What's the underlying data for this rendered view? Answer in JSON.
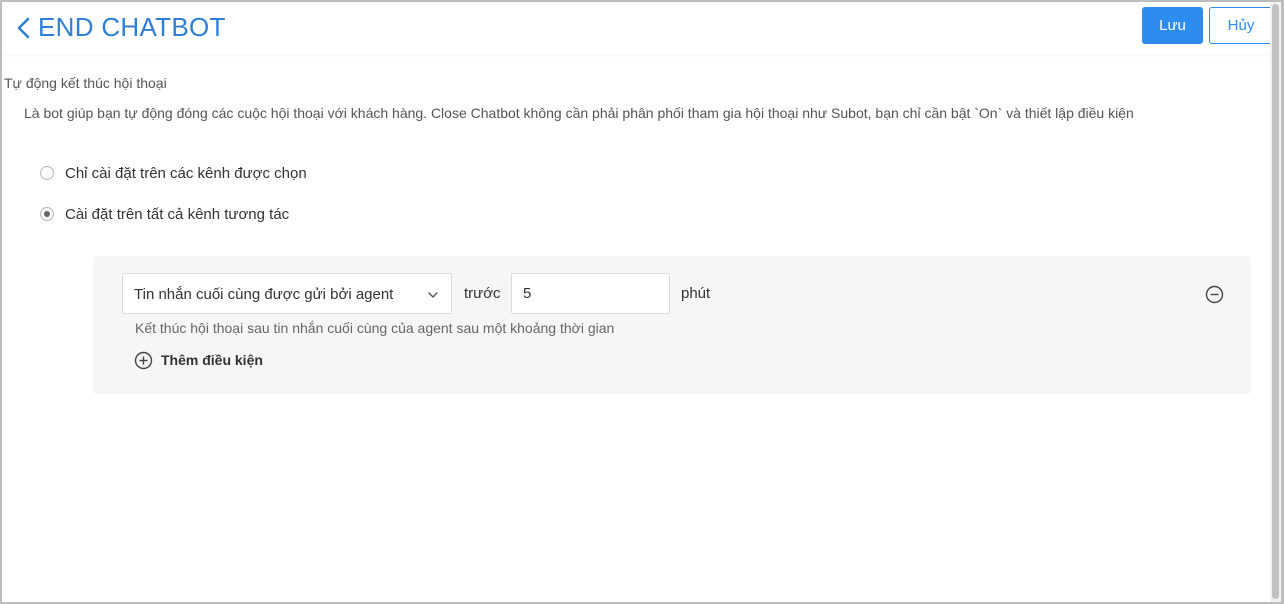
{
  "header": {
    "title": "END CHATBOT",
    "save_label": "Lưu",
    "cancel_label": "Hủy"
  },
  "content": {
    "section_title": "Tự động kết thúc hội thoại",
    "description": "Là bot giúp bạn tự động đóng các cuộc hội thoại với khách hàng. Close Chatbot không cần phải phân phối tham gia hội thoại như Subot, bạn chỉ cần bật `On` và thiết lập điều kiện",
    "options": [
      {
        "label": "Chỉ cài đặt trên các kênh được chọn",
        "checked": false
      },
      {
        "label": "Cài đặt trên tất cả kênh tương tác",
        "checked": true
      }
    ]
  },
  "condition": {
    "trigger": "Tin nhắn cuối cùng được gửi bởi agent",
    "before_label": "trước",
    "minutes_value": "5",
    "unit_label": "phút",
    "hint": "Kết thúc hội thoại sau tin nhắn cuối cùng của agent sau một khoảng thời gian",
    "add_label": "Thêm điều kiện"
  },
  "colors": {
    "accent": "#2d8cf0",
    "title": "#2f7fd6",
    "panel_bg": "#f5f6f8"
  },
  "icons": {
    "back": "chevron-left-icon",
    "dropdown": "chevron-down-icon",
    "remove": "minus-circle-icon",
    "add": "plus-circle-icon"
  }
}
